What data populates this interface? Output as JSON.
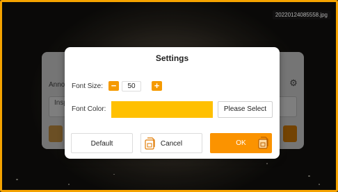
{
  "background": {
    "filename": "20220124085558.jpg"
  },
  "behind_panel": {
    "label_partial": "Anno",
    "input_partial": "Insp"
  },
  "dialog": {
    "title": "Settings",
    "font_size": {
      "label": "Font Size:",
      "value": "50",
      "decrement": "−",
      "increment": "+"
    },
    "font_color": {
      "label": "Font Color:",
      "swatch_color": "#ffc000",
      "select_label": "Please Select"
    },
    "buttons": {
      "default_label": "Default",
      "cancel_label": "Cancel",
      "ok_label": "OK"
    }
  },
  "colors": {
    "accent": "#fb9300",
    "frame_border": "#f5a300"
  }
}
